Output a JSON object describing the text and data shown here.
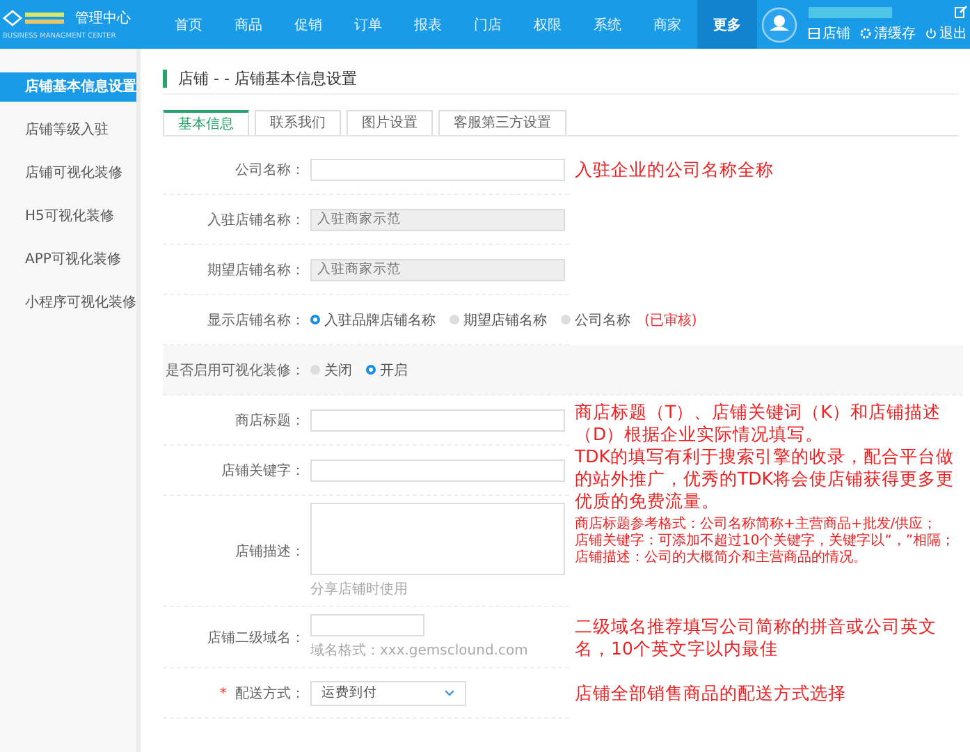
{
  "header": {
    "title": "管理中心",
    "subtitle": "BUSINESS MANAGMENT CENTER",
    "nav": [
      {
        "label": "首页",
        "selected": false
      },
      {
        "label": "商品",
        "selected": false
      },
      {
        "label": "促销",
        "selected": false
      },
      {
        "label": "订单",
        "selected": false
      },
      {
        "label": "报表",
        "selected": false
      },
      {
        "label": "门店",
        "selected": false
      },
      {
        "label": "权限",
        "selected": false
      },
      {
        "label": "系统",
        "selected": false
      },
      {
        "label": "商家",
        "selected": false
      },
      {
        "label": "更多",
        "selected": true
      }
    ],
    "links": [
      {
        "kind": "store",
        "label": "店铺"
      },
      {
        "kind": "cache",
        "label": "清缓存"
      },
      {
        "kind": "logout",
        "label": "退出"
      }
    ]
  },
  "sidebar": {
    "items": [
      {
        "label": "店铺基本信息设置",
        "selected": true
      },
      {
        "label": "店铺等级入驻",
        "selected": false
      },
      {
        "label": "店铺可视化装修",
        "selected": false
      },
      {
        "label": "H5可视化装修",
        "selected": false
      },
      {
        "label": "APP可视化装修",
        "selected": false
      },
      {
        "label": "小程序可视化装修",
        "selected": false
      }
    ]
  },
  "page_title": "店铺 - - 店铺基本信息设置",
  "tabs": [
    {
      "label": "基本信息",
      "selected": true
    },
    {
      "label": "联系我们",
      "selected": false
    },
    {
      "label": "图片设置",
      "selected": false
    },
    {
      "label": "客服第三方设置",
      "selected": false
    }
  ],
  "form": [
    {
      "rows": [
        {
          "kind": "text",
          "label": "公司名称："
        }
      ],
      "note": {
        "lines": [
          "入驻企业的公司名称全称"
        ]
      }
    },
    {
      "rows": [
        {
          "kind": "text",
          "label": "入驻店铺名称：",
          "value": "入驻商家示范",
          "disabled": true
        }
      ]
    },
    {
      "rows": [
        {
          "kind": "text",
          "label": "期望店铺名称：",
          "value": "入驻商家示范",
          "disabled": true
        }
      ]
    },
    {
      "rows": [
        {
          "kind": "radio",
          "label": "显示店铺名称：",
          "options": [
            {
              "label": "入驻品牌店铺名称",
              "selected": true
            },
            {
              "label": "期望店铺名称",
              "selected": false
            },
            {
              "label": "公司名称",
              "selected": false
            }
          ],
          "status": "(已审核)"
        }
      ]
    },
    {
      "rows": [
        {
          "kind": "radio",
          "label": "是否启用可视化装修：",
          "shaded": true,
          "options": [
            {
              "label": "关闭",
              "selected": false
            },
            {
              "label": "开启",
              "selected": true
            }
          ]
        }
      ]
    },
    {
      "rows": [
        {
          "kind": "text",
          "label": "商店标题："
        },
        {
          "kind": "text",
          "label": "店铺关键字："
        },
        {
          "kind": "textarea",
          "label": "店铺描述：",
          "hint": "分享店铺时使用"
        }
      ],
      "note": {
        "lines": [
          "商店标题（T）、店铺关键词（K）和店铺描述（D）根据企业实际情况填写。",
          "TDK的填写有利于搜索引擎的收录，配合平台做的站外推广，优秀的TDK将会使店铺获得更多更优质的免费流量。"
        ],
        "small_lines": [
          "商店标题参考格式：公司名称简称+主营商品+批发/供应；",
          "店铺关键字：可添加不超过10个关键字，关键字以“，”相隔；",
          "店铺描述：公司的大概简介和主营商品的情况。"
        ]
      }
    },
    {
      "rows": [
        {
          "kind": "short",
          "label": "店铺二级域名：",
          "hint": "域名格式：xxx.gemsclound.com"
        }
      ],
      "note": {
        "lines": [
          "二级域名推荐填写公司简称的拼音或公司英文名，10个英文字以内最佳"
        ]
      }
    },
    {
      "rows": [
        {
          "kind": "select",
          "label": "配送方式：",
          "required_mark": "*",
          "value": "运费到付"
        }
      ],
      "note": {
        "lines": [
          "店铺全部销售商品的配送方式选择"
        ]
      }
    }
  ]
}
